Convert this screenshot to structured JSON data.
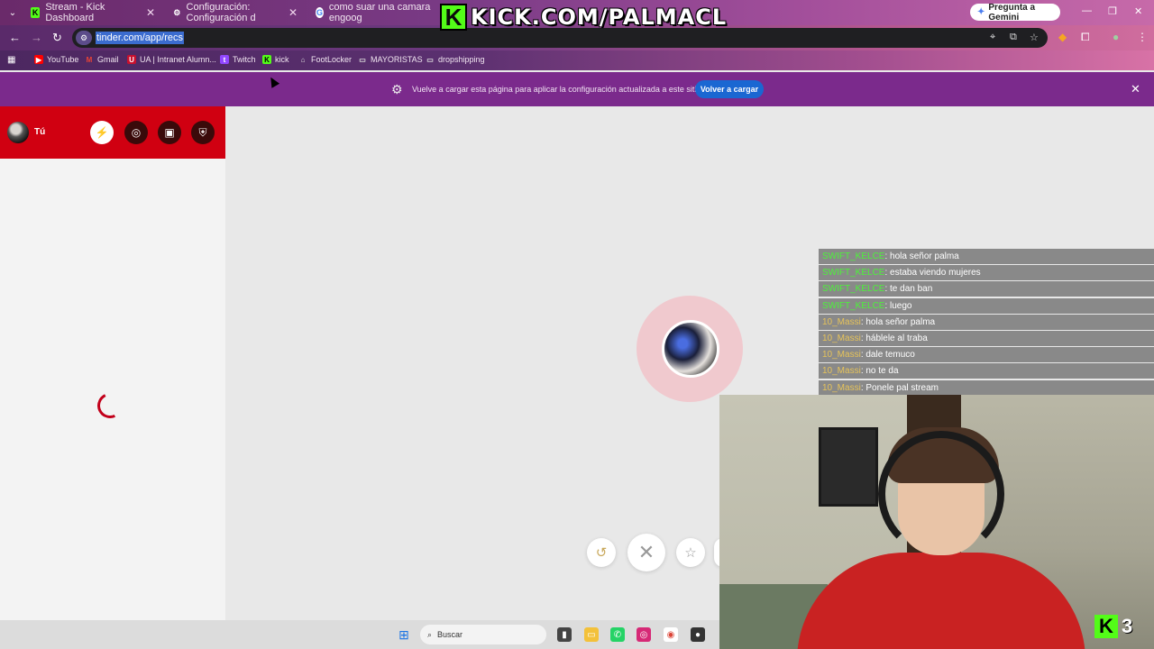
{
  "tabs": [
    {
      "title": "Stream - Kick Dashboard",
      "favicon": "kick-icon"
    },
    {
      "title": "Configuración: Configuración d",
      "favicon": "gear-icon"
    },
    {
      "title": "como suar una camara engoog",
      "favicon": "google-icon"
    }
  ],
  "banner": {
    "text": "KICK.COM/PALMACL",
    "k": "K"
  },
  "gemini": {
    "label": "Pregunta a Gemini"
  },
  "omnibox": {
    "url": "tinder.com/app/recs"
  },
  "bookmarks": [
    {
      "label": "YouTube"
    },
    {
      "label": "Gmail"
    },
    {
      "label": "UA | Intranet Alumn..."
    },
    {
      "label": "Twitch"
    },
    {
      "label": "kick"
    },
    {
      "label": "FootLocker"
    },
    {
      "label": "MAYORISTAS"
    },
    {
      "label": "dropshipping"
    }
  ],
  "infobar": {
    "message": "Vuelve a cargar esta página para aplicar la configuración actualizada a este sitio",
    "button": "Volver a cargar"
  },
  "sidebar": {
    "profile_name": "Tú"
  },
  "chat": [
    {
      "user": "SWIFT_KELCE",
      "text": " : hola señor palma",
      "color": "green"
    },
    {
      "user": "SWIFT_KELCE",
      "text": " : estaba viendo mujeres",
      "color": "green"
    },
    {
      "user": "SWIFT_KELCE",
      "text": " : te dan ban",
      "color": "green"
    },
    {
      "user": "SWIFT_KELCE",
      "text": " : luego",
      "color": "green"
    },
    {
      "user": "10_Massi",
      "text": " : hola señor palma",
      "color": "gold"
    },
    {
      "user": "10_Massi",
      "text": " : háblele al traba",
      "color": "gold"
    },
    {
      "user": "10_Massi",
      "text": " : dale temuco",
      "color": "gold"
    },
    {
      "user": "10_Massi",
      "text": " : no te da",
      "color": "gold"
    },
    {
      "user": "10_Massi",
      "text": " : Ponele pal stream",
      "color": "gold"
    }
  ],
  "kick_viewers": {
    "k": "K",
    "count": "3"
  },
  "taskbar": {
    "search_placeholder": "Buscar"
  }
}
